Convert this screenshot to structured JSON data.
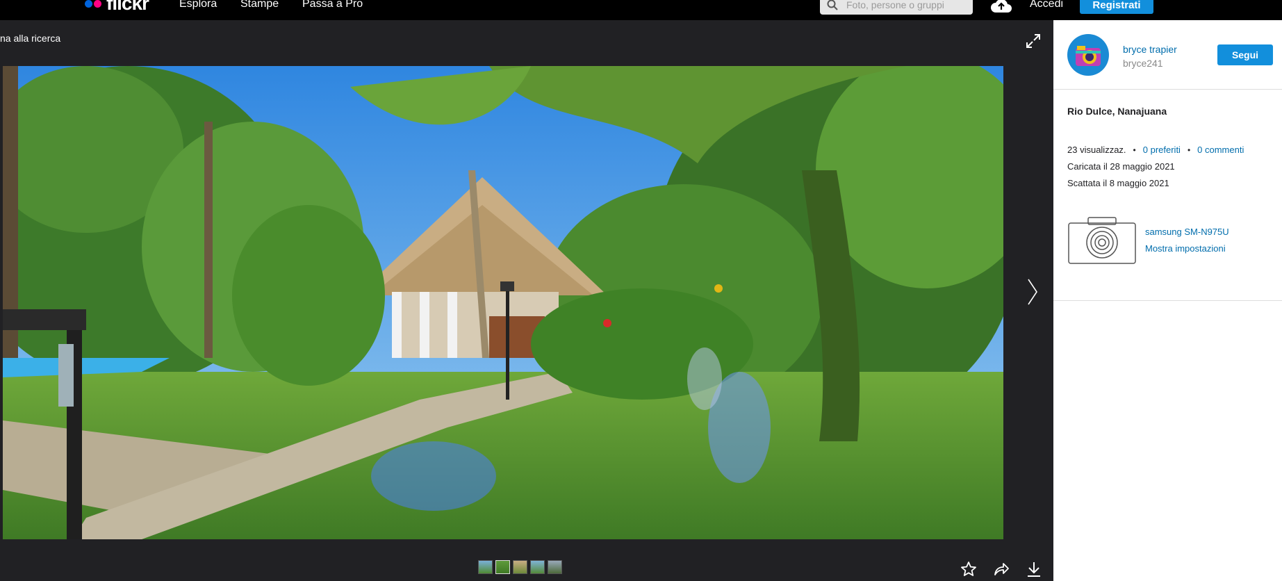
{
  "nav": {
    "logo": "flickr",
    "links": [
      "Esplora",
      "Stampe",
      "Passa a Pro"
    ],
    "search_placeholder": "Foto, persone o gruppi",
    "login": "Accedi",
    "signup": "Registrati"
  },
  "viewer": {
    "back_label": "na alla ricerca",
    "thumbnail_count": 5,
    "active_thumbnail": 2
  },
  "owner": {
    "name": "bryce trapier",
    "handle": "bryce241",
    "follow_label": "Segui"
  },
  "photo": {
    "title": "Rio Dulce, Nanajuana",
    "views": "23 visualizzaz.",
    "favorites": "0 preferiti",
    "comments": "0 commenti",
    "uploaded": "Caricata il 28 maggio 2021",
    "taken": "Scattata il 8 maggio 2021"
  },
  "camera": {
    "model": "samsung SM-N975U",
    "settings_label": "Mostra impostazioni"
  },
  "colors": {
    "accent": "#128fdc",
    "link": "#006dac",
    "dark_bg": "#212124"
  }
}
